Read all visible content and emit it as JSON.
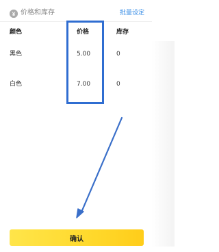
{
  "section": {
    "title": "价格和库存",
    "batch_setting": "批量设定"
  },
  "table": {
    "headers": [
      "颜色",
      "价格",
      "库存"
    ],
    "rows": [
      {
        "color": "黑色",
        "price": "5.00",
        "stock": "0"
      },
      {
        "color": "白色",
        "price": "7.00",
        "stock": "0"
      }
    ]
  },
  "footer": {
    "confirm_label": "确认"
  },
  "colors": {
    "accent": "#3a8ee6",
    "annotation": "#2f6dd1",
    "button": "#ffdb33"
  },
  "icons": {
    "section_icon": "coin-icon"
  }
}
